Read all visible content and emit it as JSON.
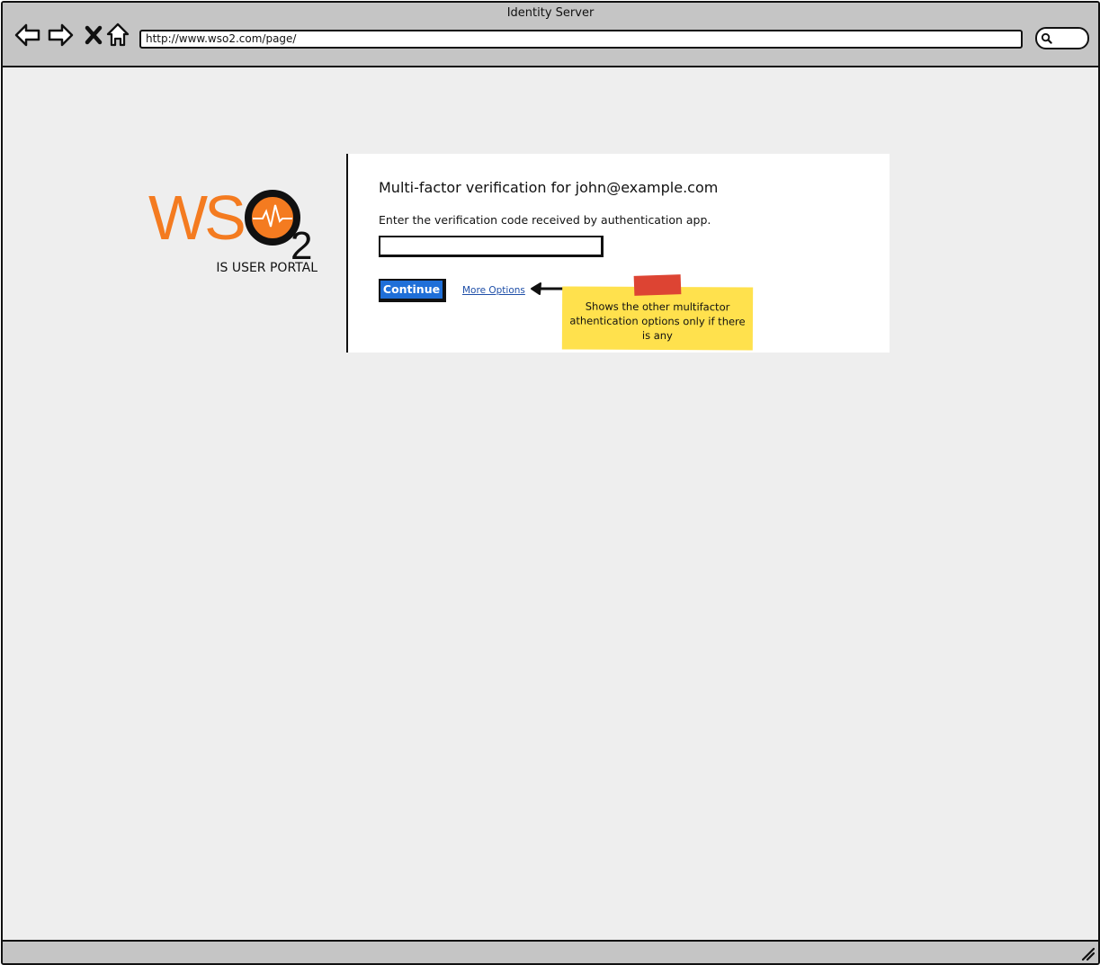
{
  "window": {
    "title": "Identity Server"
  },
  "browser": {
    "url": "http://www.wso2.com/page/",
    "nav_icons": [
      "back-arrow-icon",
      "forward-arrow-icon",
      "close-x-icon",
      "home-icon"
    ],
    "search_icon": "search-icon"
  },
  "brand": {
    "logo_text": "WSO2",
    "portal_label": "IS USER PORTAL",
    "colors": {
      "logo_orange": "#f47b20",
      "logo_dark": "#111111"
    }
  },
  "card": {
    "title": "Multi-factor verification for john@example.com",
    "description": "Enter the verification code received by authentication app.",
    "code_input": {
      "value": "",
      "placeholder": ""
    },
    "continue_label": "Continue",
    "more_options_label": "More Options"
  },
  "annotation": {
    "note_text": "Shows the other multifactor athentication options only if there is any",
    "colors": {
      "sticky": "#ffe14d",
      "tape": "#dd4433"
    }
  },
  "colors": {
    "primary_button": "#1f6fd8",
    "link": "#1f4fa8",
    "window_bg": "#eeeeee",
    "chrome": "#c5c5c5"
  }
}
